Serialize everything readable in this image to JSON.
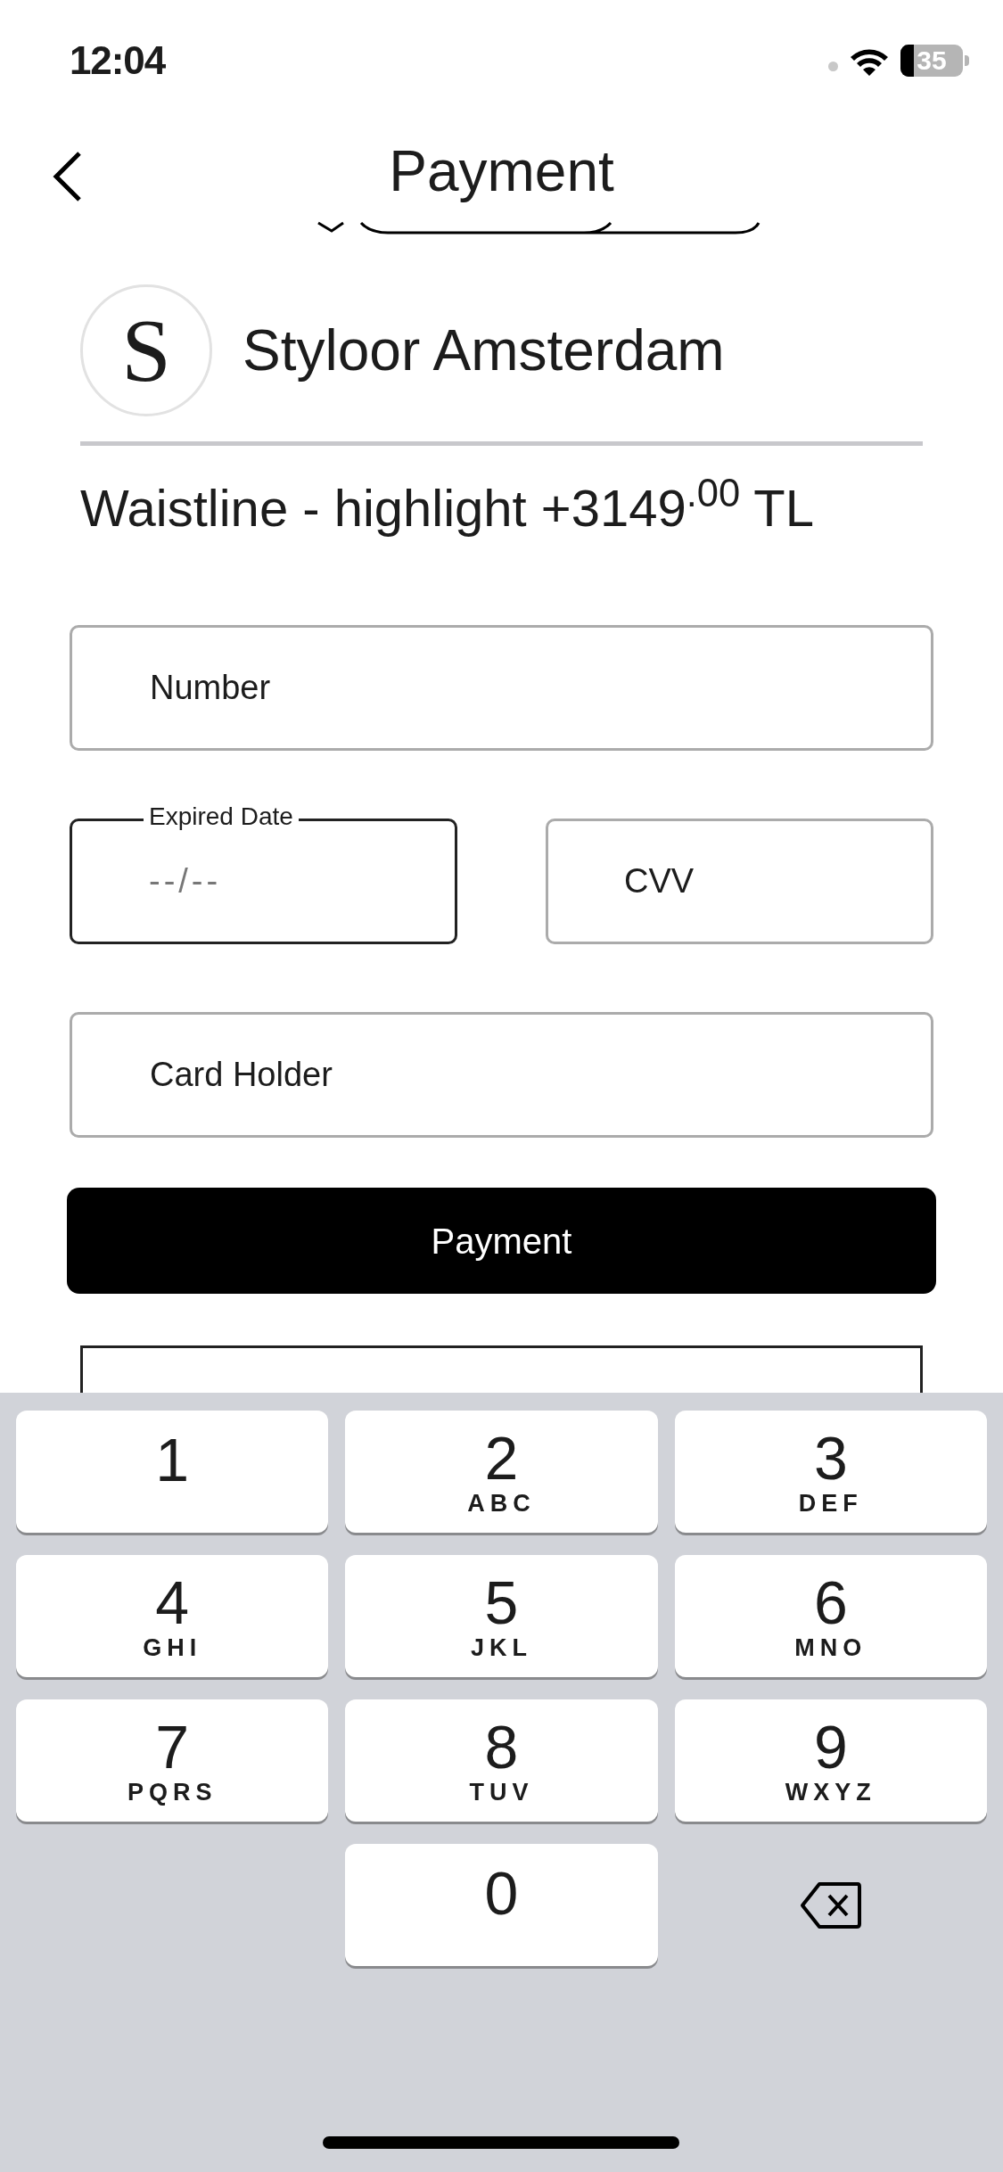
{
  "status_bar": {
    "time": "12:04",
    "battery": "35"
  },
  "header": {
    "title": "Payment"
  },
  "store": {
    "name": "Styloor Amsterdam",
    "logo_letter": "S"
  },
  "product": {
    "title": "Waistline - highlight +3149$^{.00}$ TL"
  },
  "fields": [
    {
      "label": "Number",
      "focused": false
    },
    {
      "label": "Expired Date",
      "focused": true,
      "placeholder": "--/--"
    },
    {
      "label": "CVV",
      "focused": false
    },
    {
      "label": "Card Holder",
      "focused": false
    }
  ],
  "payment_button": "Payment",
  "keyboard": {
    "rows": [
      [
        {
          "kind": "digit",
          "digit": "1"
        },
        {
          "kind": "digit",
          "digit": "2",
          "letters": "ABC"
        },
        {
          "kind": "digit",
          "digit": "3",
          "letters": "DEF"
        }
      ],
      [
        {
          "kind": "digit",
          "digit": "4",
          "letters": "GHI"
        },
        {
          "kind": "digit",
          "digit": "5",
          "letters": "JKL"
        },
        {
          "kind": "digit",
          "digit": "6",
          "letters": "MNO"
        }
      ],
      [
        {
          "kind": "digit",
          "digit": "7",
          "letters": "PQRS"
        },
        {
          "kind": "digit",
          "digit": "8",
          "letters": "TUV"
        },
        {
          "kind": "digit",
          "digit": "9",
          "letters": "WXYZ"
        }
      ],
      [
        {
          "kind": "blank"
        },
        {
          "kind": "digit",
          "digit": "0"
        },
        {
          "kind": "delete"
        }
      ]
    ]
  }
}
